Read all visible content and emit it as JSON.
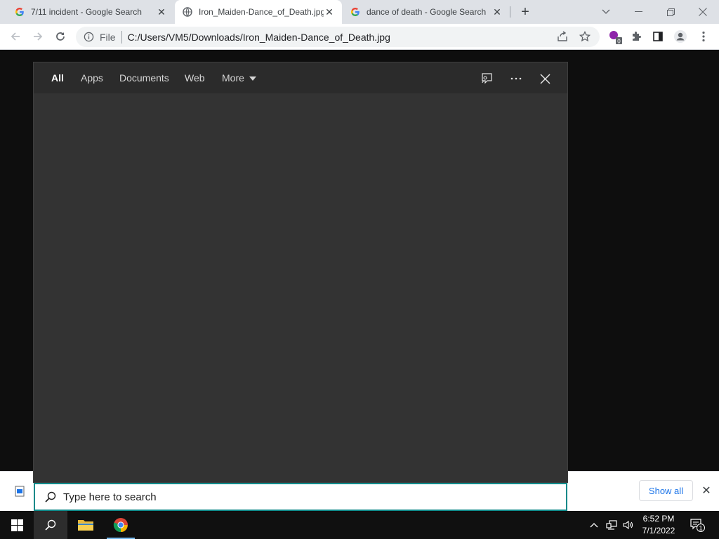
{
  "browser": {
    "tabs": [
      {
        "title": "7/11 incident - Google Search",
        "favicon": "google-icon",
        "active": false
      },
      {
        "title": "Iron_Maiden-Dance_of_Death.jpg",
        "favicon": "globe-icon",
        "active": true
      },
      {
        "title": "dance of death - Google Search",
        "favicon": "google-icon",
        "active": false
      }
    ],
    "omnibox": {
      "scheme": "File",
      "url": "C:/Users/VM5/Downloads/Iron_Maiden-Dance_of_Death.jpg"
    },
    "extension_badge": "0"
  },
  "download_shelf": {
    "show_all_label": "Show all"
  },
  "search_panel": {
    "tabs": [
      "All",
      "Apps",
      "Documents",
      "Web",
      "More"
    ],
    "active_tab": "All",
    "search_placeholder": "Type here to search"
  },
  "taskbar": {
    "time": "6:52 PM",
    "date": "7/1/2022",
    "notification_count": "1"
  },
  "colors": {
    "search_accent": "#0e8a8a",
    "panel_bg": "#333333",
    "taskbar_bg": "#101010"
  }
}
